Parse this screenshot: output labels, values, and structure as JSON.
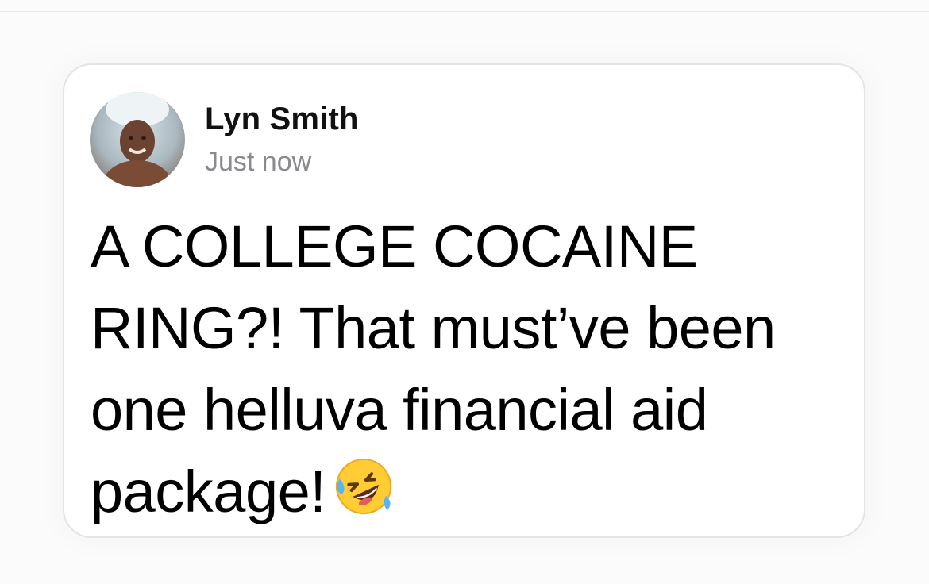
{
  "post": {
    "author": "Lyn Smith",
    "timestamp": "Just now",
    "text": "A COLLEGE COCAINE RING?! That must’ve been one helluva financial aid package!",
    "emoji": "rolling-on-floor-laughing-emoji"
  },
  "colors": {
    "background": "#fbfbfb",
    "card": "#ffffff",
    "card_border": "#e3e3e8",
    "name": "#111111",
    "timestamp": "#8a8a8e",
    "text": "#000000"
  }
}
